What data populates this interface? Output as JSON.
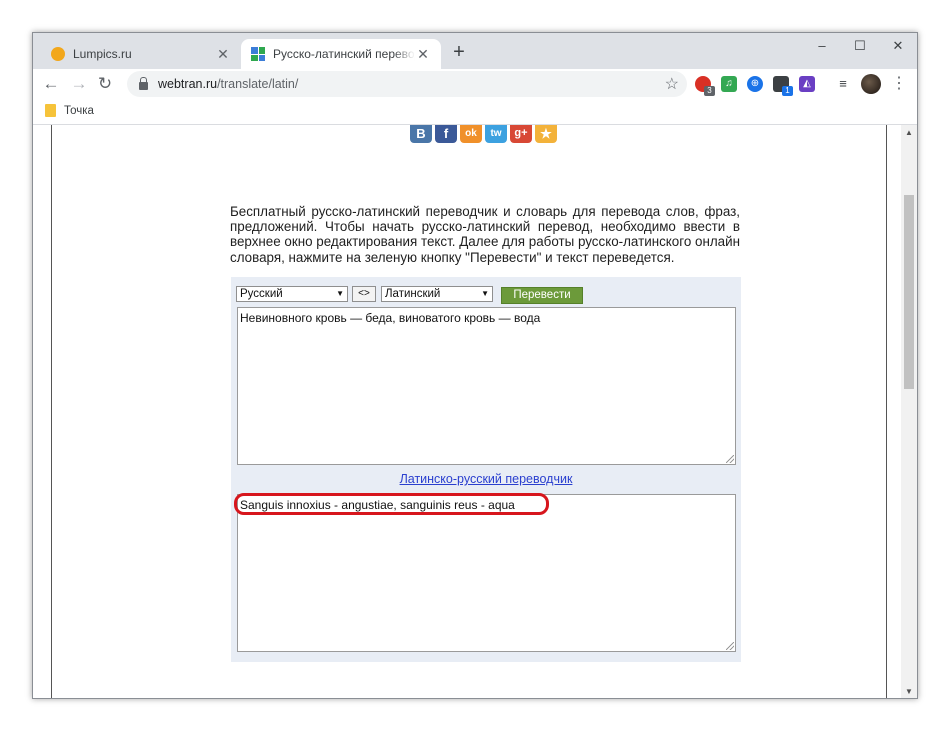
{
  "browser": {
    "tabs": [
      {
        "title": "Lumpics.ru",
        "favicon": "orange-circle-favicon",
        "active": false
      },
      {
        "title": "Русско-латинский переводчик с",
        "favicon": "webtran-favicon",
        "active": true
      }
    ],
    "new_tab": "+",
    "window_controls": {
      "minimize": "–",
      "maximize": "☐",
      "close": "✕"
    },
    "nav": {
      "back": "←",
      "forward": "→",
      "reload": "↻"
    },
    "url": {
      "host": "webtran.ru",
      "path": "/translate/latin/"
    },
    "bookmark_star": "☆",
    "extensions": [
      {
        "name": "opera-red-extension-icon",
        "badge": "3"
      },
      {
        "name": "music-green-extension-icon",
        "badge": ""
      },
      {
        "name": "globe-blue-extension-icon",
        "badge": ""
      },
      {
        "name": "cube-extension-icon",
        "badge": "1"
      },
      {
        "name": "purple-extension-icon",
        "badge": ""
      }
    ],
    "menu": "⋮",
    "bookmarks": [
      {
        "label": "Точка"
      }
    ]
  },
  "page": {
    "social_buttons": [
      "В",
      "f",
      "ok",
      "tw",
      "g+",
      "★"
    ],
    "description": "Бесплатный русско-латинский переводчик и словарь для перевода слов, фраз, предложений. Чтобы начать русско-латинский перевод, необходимо ввести в верхнее окно редактирования текст. Далее для работы русско-латинского онлайн словаря, нажмите на зеленую кнопку \"Перевести\" и текст переведется.",
    "translator": {
      "source_lang": "Русский",
      "swap_label": "<>",
      "target_lang": "Латинский",
      "translate_button": "Перевести",
      "source_text": "Невиновного кровь — беда, виноватого кровь — вода",
      "reverse_link": "Латинско-русский переводчик",
      "result_text": "Sanguis innoxius - angustiae, sanguinis reus - aqua"
    }
  },
  "colors": {
    "accent_green": "#6c9a3a",
    "highlight_red": "#d7161d",
    "link_blue": "#2a3fcf",
    "panel_bg": "#e8edf5"
  }
}
